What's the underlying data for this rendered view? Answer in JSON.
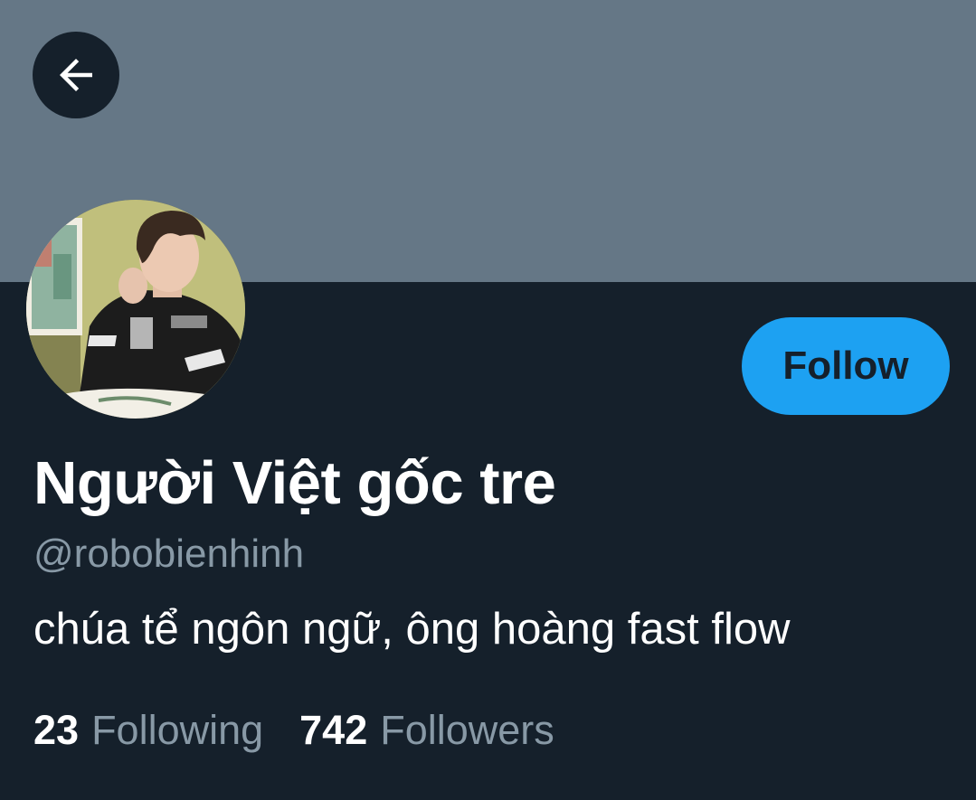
{
  "header": {
    "back_icon": "arrow-left-icon",
    "banner_color": "#657786"
  },
  "profile": {
    "avatar": "profile-photo",
    "display_name": "Người Việt gốc tre",
    "handle": "@robobienhinh",
    "bio": "chúa tể ngôn ngữ, ông hoàng fast flow",
    "follow_label": "Follow"
  },
  "stats": {
    "following_count": "23",
    "following_label": "Following",
    "followers_count": "742",
    "followers_label": "Followers"
  },
  "colors": {
    "background": "#15202b",
    "accent": "#1da1f2",
    "secondary_text": "#8899a6"
  }
}
